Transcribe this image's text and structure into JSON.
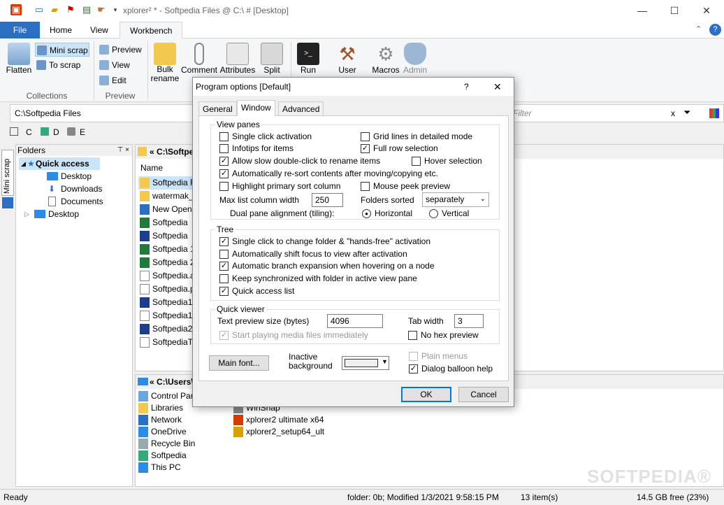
{
  "window": {
    "title": "xplorer² * - Softpedia Files @ C:\\ # [Desktop]",
    "min": "—",
    "max": "☐",
    "close": "✕"
  },
  "qa_icons": [
    "app-icon",
    "new-folder-icon",
    "open-folder-icon",
    "bookmark-icon",
    "clipboard-icon",
    "hand-icon",
    "dropdown-icon"
  ],
  "ribbon_tabs": {
    "file": "File",
    "home": "Home",
    "view": "View",
    "workbench": "Workbench"
  },
  "ribbon": {
    "flatten": "Flatten",
    "mini_scrap": "Mini scrap",
    "to_scrap": "To scrap",
    "collections": "Collections",
    "preview_btn": "Preview",
    "view_btn": "View",
    "edit_btn": "Edit",
    "preview_grp": "Preview",
    "bulk_rename": "Bulk rename",
    "comment": "Comment",
    "attributes": "Attributes",
    "split": "Split",
    "run": "Run",
    "user": "User",
    "macros": "Macros",
    "admin": "Admin"
  },
  "address": {
    "path": "C:\\Softpedia Files",
    "filter_placeholder": "Filter",
    "clear": "x"
  },
  "drives": [
    "C",
    "D",
    "E"
  ],
  "left_strip": {
    "mini_scrap": "Mini scrap"
  },
  "folders": {
    "header": "Folders",
    "pin": "⊤ ×",
    "quick_access": "Quick access",
    "desktop": "Desktop",
    "downloads": "Downloads",
    "documents": "Documents",
    "desktop_root": "Desktop"
  },
  "pane1": {
    "path": "« C:\\Softpe",
    "col_name": "Name",
    "files": [
      "Softpedia F",
      "watermak_",
      "New OpenI",
      "Softpedia",
      "Softpedia",
      "Softpedia 1",
      "Softpedia 2",
      "Softpedia.a",
      "Softpedia.p",
      "Softpedia1",
      "Softpedia1.",
      "Softpedia2",
      "SoftpediaTe"
    ]
  },
  "pane2": {
    "path": "« C:\\Users\\",
    "items": [
      "Control Pan",
      "Libraries",
      "Network",
      "OneDrive",
      "Recycle Bin",
      "Softpedia",
      "This PC"
    ],
    "items2": [
      "WinSnap",
      "xplorer2 ultimate x64",
      "xplorer2_setup64_ult"
    ]
  },
  "status": {
    "ready": "Ready",
    "folder": "folder: 0b; Modified 1/3/2021 9:58:15 PM",
    "count": "13 item(s)",
    "free": "14.5 GB free (23%)"
  },
  "dialog": {
    "title": "Program options [Default]",
    "help": "?",
    "close": "✕",
    "tabs": [
      "General",
      "Window",
      "Advanced"
    ],
    "view_panes": "View panes",
    "single_click": "Single click activation",
    "grid_lines": "Grid lines in detailed mode",
    "infotips": "Infotips for items",
    "full_row": "Full row selection",
    "slow_dbl": "Allow slow double-click to rename items",
    "hover_sel": "Hover selection",
    "auto_resort": "Automatically re-sort contents after moving/copying etc.",
    "highlight_sort": "Highlight primary sort column",
    "mouse_peek": "Mouse peek preview",
    "max_col_label": "Max list column width",
    "max_col_value": "250",
    "folders_sorted_label": "Folders sorted",
    "folders_sorted_value": "separately",
    "dual_pane_label": "Dual pane alignment (tiling):",
    "horizontal": "Horizontal",
    "vertical": "Vertical",
    "tree": "Tree",
    "single_click_folder": "Single click to change folder & \"hands-free\" activation",
    "auto_shift": "Automatically shift focus to view after activation",
    "auto_branch": "Automatic branch expansion when hovering on a node",
    "keep_sync": "Keep synchronized with folder in active view pane",
    "quick_access_list": "Quick access list",
    "quick_viewer": "Quick viewer",
    "text_preview_label": "Text preview size (bytes)",
    "text_preview_value": "4096",
    "tab_width_label": "Tab width",
    "tab_width_value": "3",
    "start_playing": "Start playing media files immediately",
    "no_hex": "No hex preview",
    "main_font": "Main font...",
    "inactive_bg": "Inactive background",
    "plain_menus": "Plain menus",
    "balloon_help": "Dialog balloon help",
    "ok": "OK",
    "cancel": "Cancel"
  },
  "watermark": "SOFTPEDIA®"
}
